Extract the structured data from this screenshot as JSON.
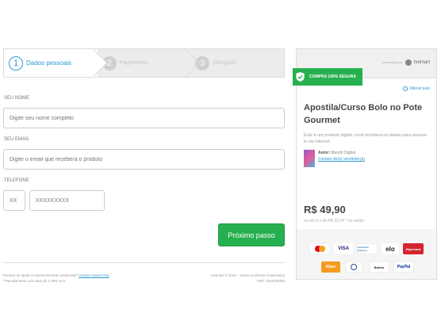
{
  "steps": [
    {
      "num": "1",
      "label": "Dados pessoais"
    },
    {
      "num": "2",
      "label": "Pagamento"
    },
    {
      "num": "3",
      "label": "Obrigado!"
    }
  ],
  "form": {
    "name_label": "SEU NOME",
    "name_placeholder": "Digite seu nome completo",
    "email_label": "SEU EMAIL",
    "email_placeholder": "Digite o email que receberá o produto",
    "phone_label": "TELEFONE",
    "ddd_placeholder": "XX",
    "phone_placeholder": "XXXXXXXXX",
    "next_button": "Próximo passo"
  },
  "footer": {
    "help_text": "Precisa de ajuda no preenchimento desta tela?",
    "help_link": "Acesse nossa FAQ",
    "installment_note": "*Parcelamento com taxa de 2,49% a.m.",
    "copyright": "Hotmart © 2018 - Todos os direitos reservados",
    "ref": "REF: D83106086"
  },
  "panel": {
    "badge": "COMPRA 100% SEGURA",
    "vendor_prefix": "intermediado por",
    "vendor": "hotmart",
    "change_country": "Alterar país",
    "title": "Apostila/Curso Bolo no Pote Gourmet",
    "description": "Este é um produto digital, você receberá os dados para acessá-lo via internet.",
    "author_label": "Autor:",
    "author_name": "Mundo Digital",
    "contact_link": "Contato do(a) vendedor(a)",
    "price": "R$ 49,90",
    "installments": "ou em 5 x de R$ 10,74 * no cartão"
  },
  "payment_methods": [
    "Mastercard",
    "VISA",
    "American Express",
    "elo",
    "Hipercard",
    "Boleto",
    "Hiper",
    "Diners Club",
    "PayPal"
  ],
  "colors": {
    "accent": "#2d9ad6",
    "success": "#27b04f"
  }
}
